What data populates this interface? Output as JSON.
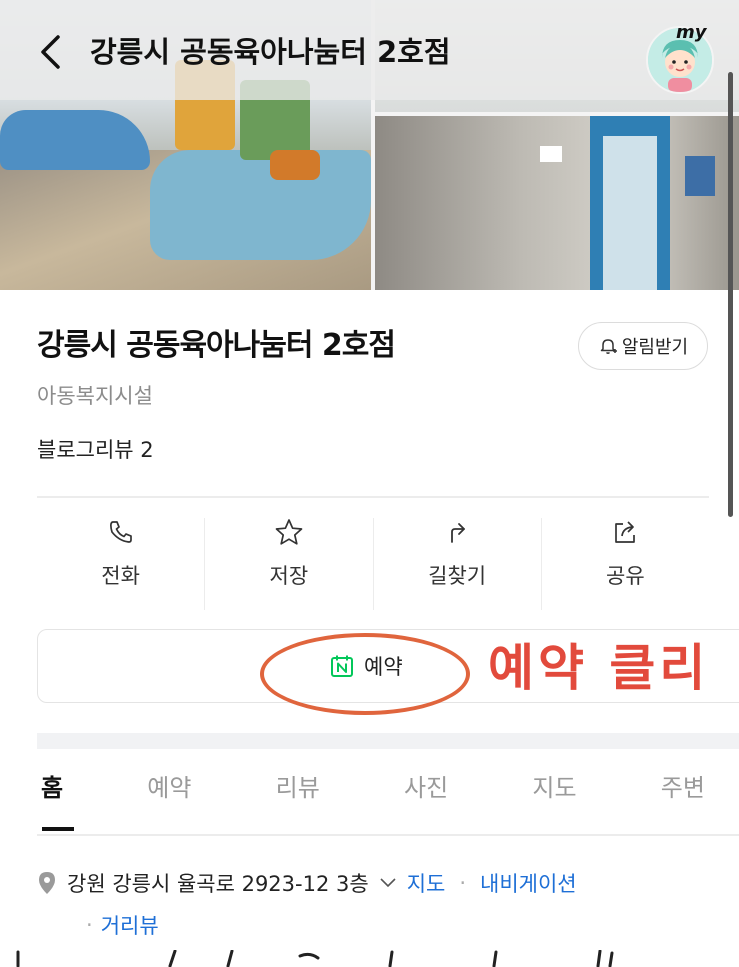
{
  "header": {
    "title": "강릉시 공동육아나눔터 2호점",
    "avatar_tag": "my"
  },
  "place": {
    "title": "강릉시 공동육아나눔터 2호점",
    "category": "아동복지시설",
    "blog_review": "블로그리뷰 2",
    "alarm_label": "알림받기"
  },
  "actions": [
    {
      "label": "전화",
      "icon": "phone-icon"
    },
    {
      "label": "저장",
      "icon": "star-icon"
    },
    {
      "label": "길찾기",
      "icon": "directions-icon"
    },
    {
      "label": "공유",
      "icon": "share-icon"
    }
  ],
  "reserve": {
    "label": "예약",
    "icon": "naver-calendar-icon"
  },
  "annotation": "예약 클리",
  "tabs": [
    "홈",
    "예약",
    "리뷰",
    "사진",
    "지도",
    "주변"
  ],
  "address": {
    "text": "강원 강릉시 율곡로 2923-12 3층",
    "links": [
      "지도",
      "내비게이션",
      "거리뷰"
    ]
  },
  "colors": {
    "link": "#1e6fd6",
    "annotation": "#e24a3c",
    "naver_green": "#03c75a"
  }
}
